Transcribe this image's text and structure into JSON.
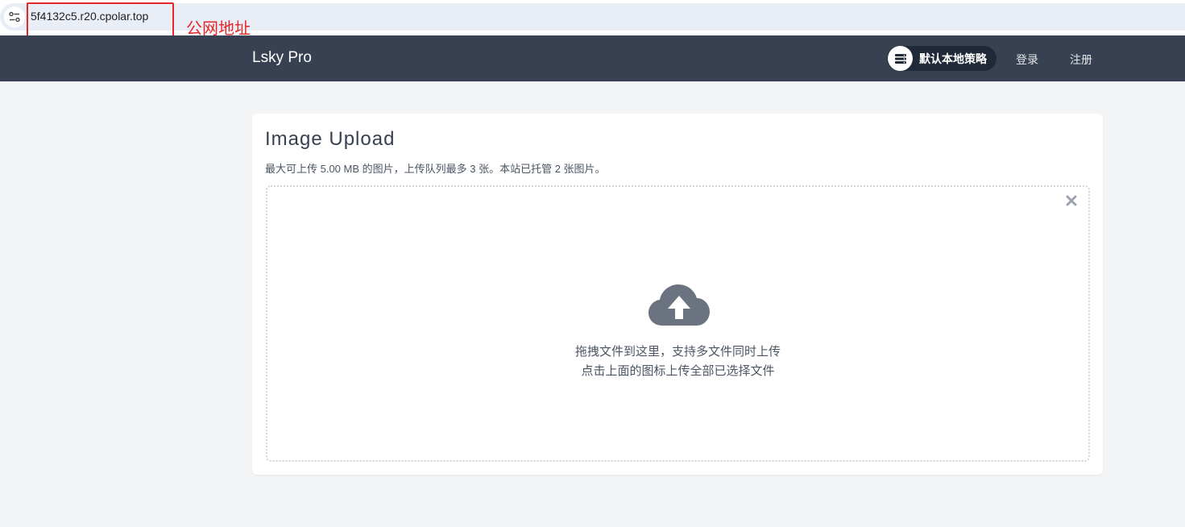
{
  "browser": {
    "url": "5f4132c5.r20.cpolar.top",
    "site_info_icon": "tune-icon"
  },
  "annotation": {
    "label": "公网地址",
    "color": "#e5262a"
  },
  "navbar": {
    "brand": "Lsky Pro",
    "strategy_label": "默认本地策略",
    "strategy_icon": "server-icon",
    "login_label": "登录",
    "register_label": "注册",
    "background": "#374151"
  },
  "upload": {
    "title": "Image Upload",
    "subtitle": "最大可上传 5.00 MB 的图片，上传队列最多 3 张。本站已托管 2 张图片。",
    "clear_icon": "close-icon",
    "upload_icon": "cloud-upload-icon",
    "hint_line1": "拖拽文件到这里，支持多文件同时上传",
    "hint_line2": "点击上面的图标上传全部已选择文件"
  }
}
